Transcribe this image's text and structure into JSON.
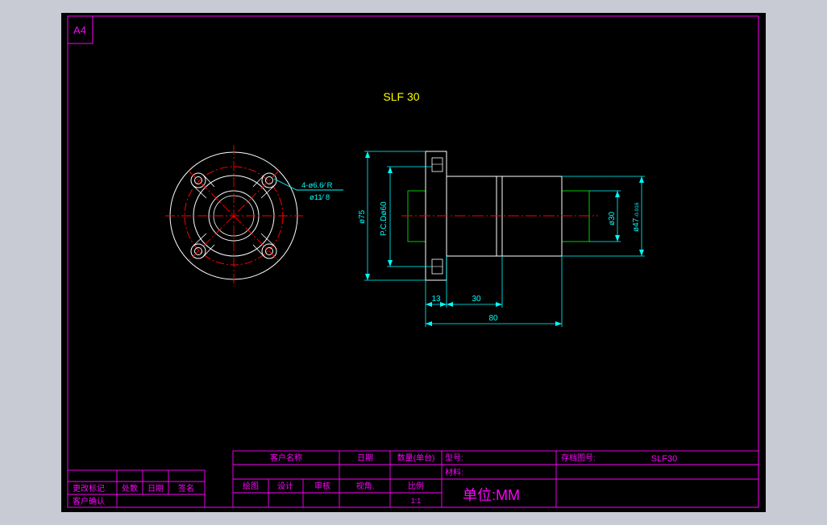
{
  "sheet": {
    "size_label": "A4",
    "title": "SLF 30"
  },
  "front_view": {
    "hole_note_line1": "4-ø6.6∕ R",
    "hole_note_line2": "ø11∕ 8"
  },
  "side_view": {
    "dim_flange_od": "ø75",
    "dim_pcd": "P.C.Dø60",
    "dim_bore": "ø30",
    "dim_body_od": "ø47",
    "dim_body_tol": "-0.016",
    "dim_flange_thk": "13",
    "dim_step": "30",
    "dim_total_len": "80"
  },
  "title_block": {
    "customer_name": "客户名称",
    "date": "日期",
    "quantity": "数量(单台)",
    "model_no": "型号:",
    "archive_no": "存档图号:",
    "archive_val": "SLF30",
    "material": "材料:",
    "drawn": "绘图",
    "designed": "设计",
    "reviewed": "审核",
    "view": "视角.",
    "scale_label": "比例",
    "scale_val": "1:1",
    "unit": "单位:MM",
    "rev_mark": "更改标记",
    "rev_count": "处数",
    "rev_date": "日期",
    "rev_sign": "签名",
    "customer_confirm": "客户确认"
  },
  "colors": {
    "background": "#000000",
    "frame": "#ff00ff",
    "title": "#ffff00",
    "outline": "#ffffff",
    "centerline": "#ff0000",
    "dimension": "#00ffff",
    "hidden": "#00cc00"
  }
}
